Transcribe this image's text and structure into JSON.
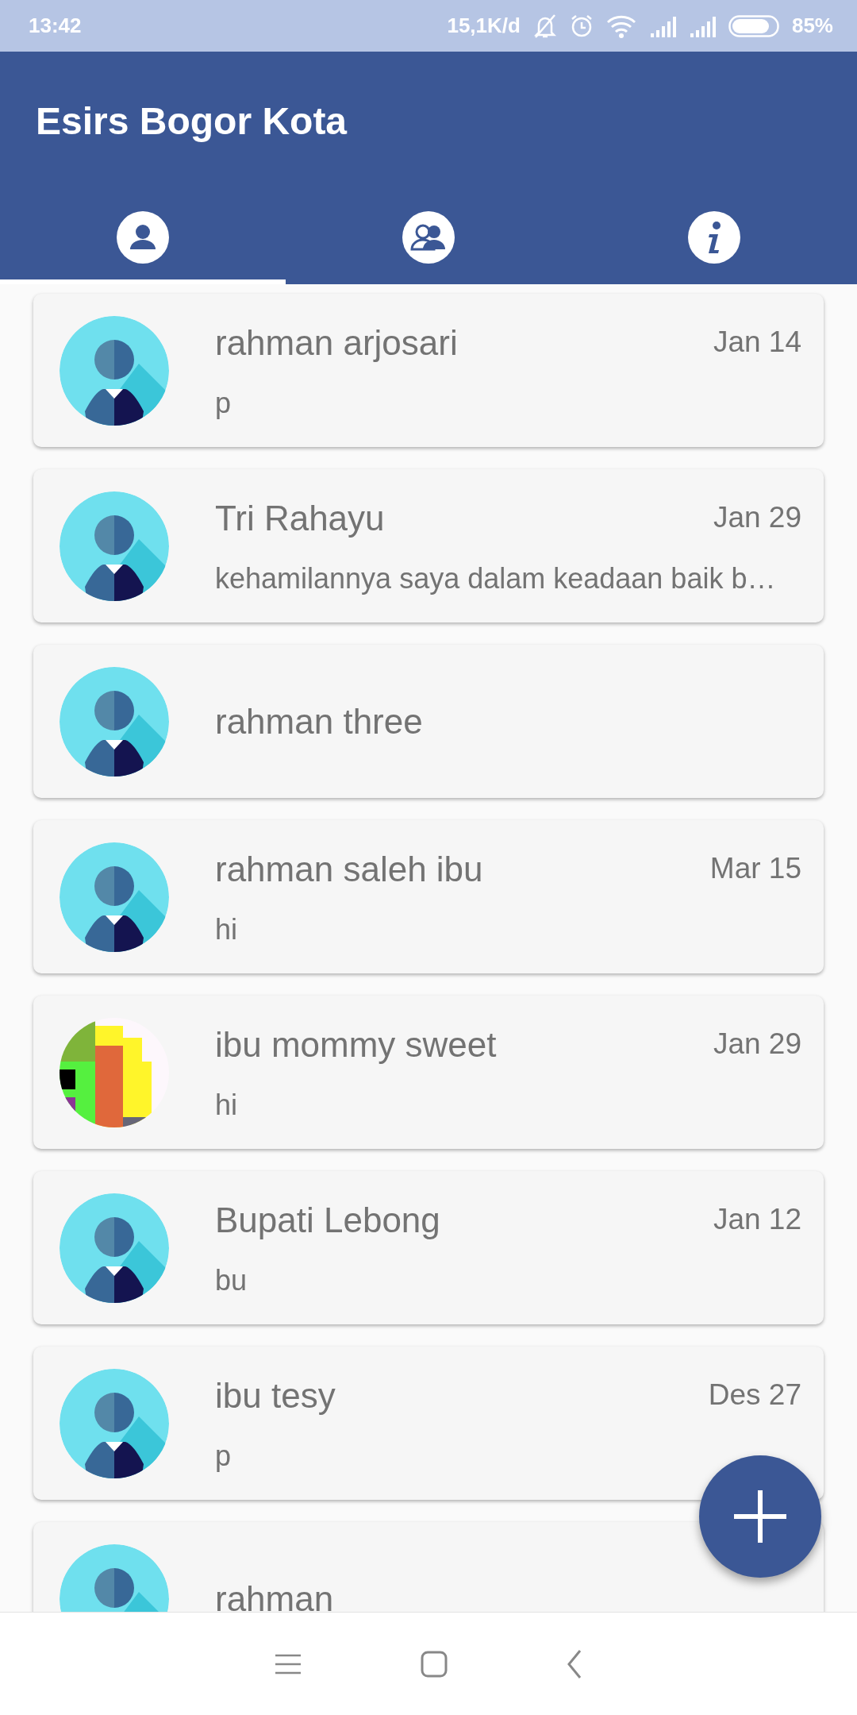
{
  "status_bar": {
    "time": "13:42",
    "net_speed": "15,1K/d",
    "battery": "85%"
  },
  "app_bar": {
    "title": "Esirs Bogor Kota"
  },
  "tabs": [
    {
      "kind": "person",
      "selected": true
    },
    {
      "kind": "group",
      "selected": false
    },
    {
      "kind": "info",
      "selected": false
    }
  ],
  "chats": [
    {
      "name": "rahman arjosari",
      "date": "Jan 14",
      "message": "p",
      "kind": "contact"
    },
    {
      "name": "Tri Rahayu",
      "date": "Jan 29",
      "message": "kehamilannya saya dalam keadaan baik b…",
      "kind": "contact"
    },
    {
      "name": "rahman three",
      "kind": "contact"
    },
    {
      "name": "rahman saleh ibu",
      "date": "Mar 15",
      "message": "hi",
      "kind": "contact"
    },
    {
      "name": "ibu mommy sweet",
      "date": "Jan 29",
      "message": "hi",
      "kind": "picture"
    },
    {
      "name": "Bupati Lebong",
      "date": "Jan 12",
      "message": "bu",
      "kind": "contact"
    },
    {
      "name": "ibu tesy",
      "date": "Des 27",
      "message": "p",
      "kind": "contact"
    },
    {
      "name": "rahman",
      "kind": "contact"
    }
  ]
}
